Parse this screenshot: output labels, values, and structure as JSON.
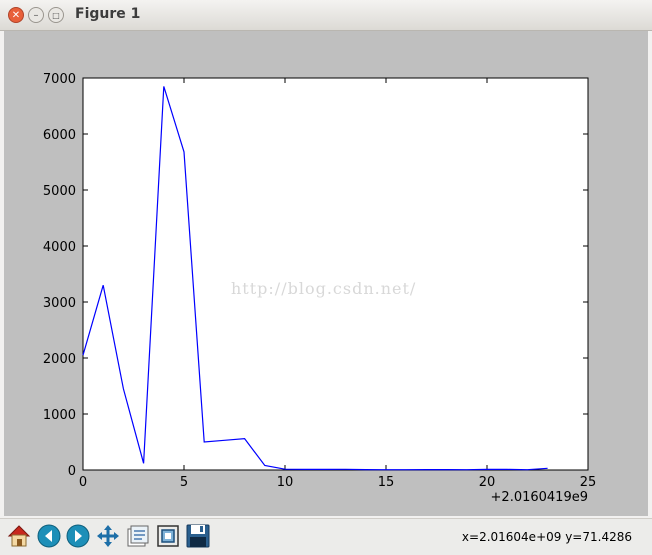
{
  "window": {
    "title": "Figure 1"
  },
  "statusbar": {
    "coords": "x=2.01604e+09  y=71.4286"
  },
  "toolbar": {
    "icons": [
      "home-icon",
      "back-icon",
      "forward-icon",
      "pan-icon",
      "subplots-icon",
      "zoom-icon",
      "save-icon"
    ]
  },
  "watermark": "http://blog.csdn.net/",
  "chart_data": {
    "type": "line",
    "title": "",
    "xlabel": "",
    "ylabel": "",
    "x_offset_label": "+2.0160419e9",
    "xlim": [
      0,
      25
    ],
    "ylim": [
      0,
      7000
    ],
    "x_ticks": [
      0,
      5,
      10,
      15,
      20,
      25
    ],
    "y_ticks": [
      0,
      1000,
      2000,
      3000,
      4000,
      5000,
      6000,
      7000
    ],
    "grid": false,
    "series": [
      {
        "color": "#0000ff",
        "x": [
          0,
          1,
          2,
          3,
          4,
          5,
          6,
          7,
          8,
          9,
          10,
          11,
          12,
          13,
          14,
          15,
          16,
          17,
          18,
          19,
          20,
          21,
          22,
          23
        ],
        "y": [
          2050,
          3300,
          1450,
          120,
          6850,
          5680,
          500,
          530,
          560,
          80,
          15,
          10,
          10,
          12,
          8,
          5,
          5,
          8,
          8,
          5,
          10,
          10,
          5,
          30
        ]
      }
    ]
  }
}
